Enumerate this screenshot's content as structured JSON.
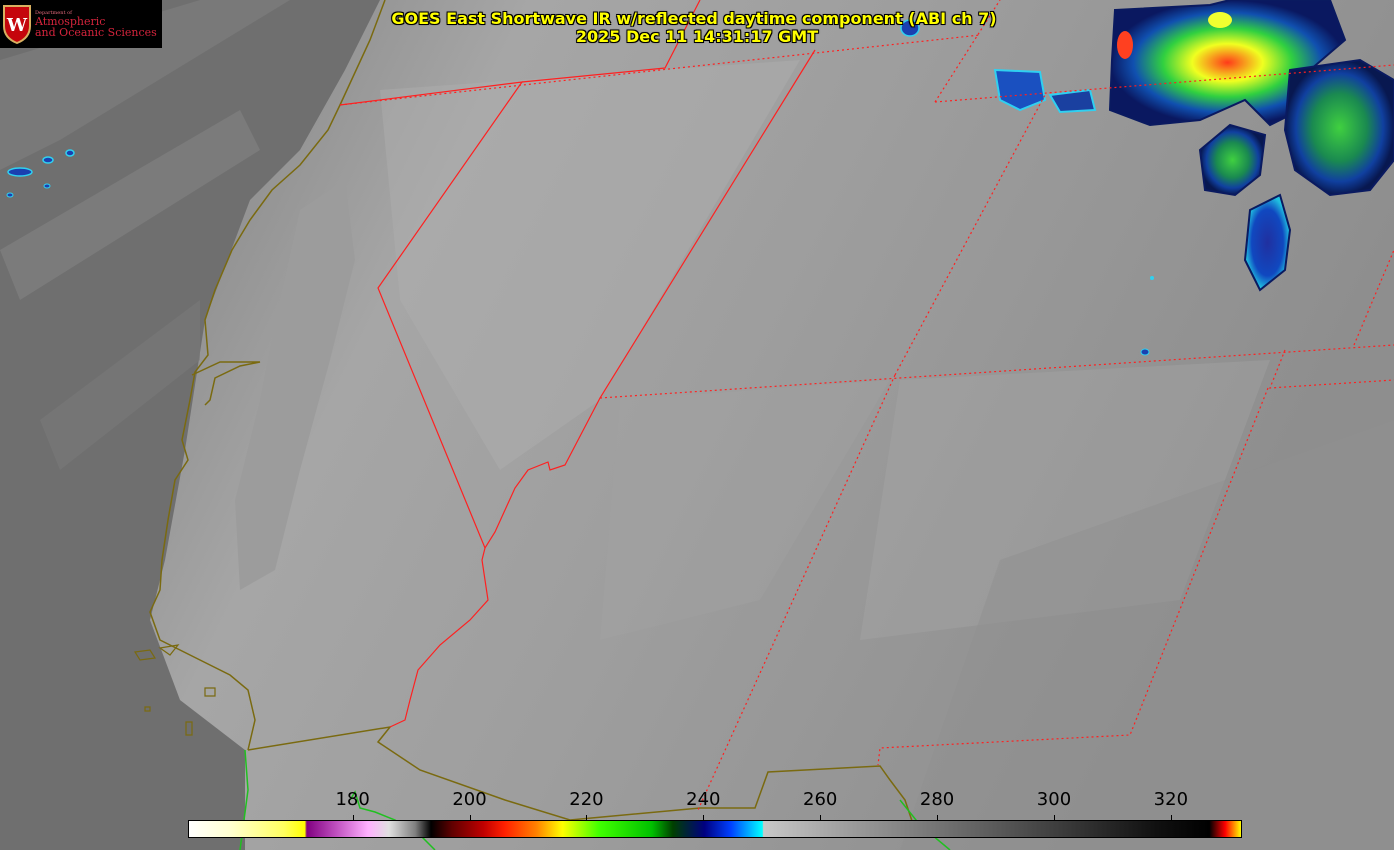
{
  "header": {
    "title": "GOES East Shortwave IR w/reflected daytime component (ABI ch 7)",
    "timestamp": "2025 Dec 11 14:31:17 GMT"
  },
  "logo": {
    "department_line": "Department of",
    "line1": "Atmospheric",
    "line2": "and Oceanic Sciences",
    "crest_letter": "W",
    "icon": "university-crest-icon"
  },
  "colorbar": {
    "ticks": [
      "180",
      "200",
      "220",
      "240",
      "260",
      "280",
      "300",
      "320"
    ],
    "range": [
      152,
      332
    ]
  },
  "colors": {
    "border_state": "#ff2020",
    "coastline": "#7a6a10",
    "coastline_green": "#20c020",
    "title_text": "#ffff00"
  }
}
